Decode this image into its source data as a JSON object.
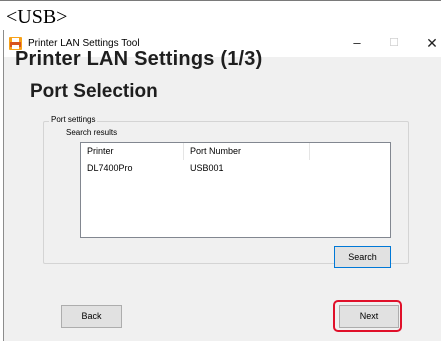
{
  "caption": "<USB>",
  "window": {
    "title": "Printer LAN Settings Tool",
    "controls": {
      "minimize": "–",
      "maximize": "☐",
      "close": "✕"
    }
  },
  "heading": "Printer LAN Settings (1/3)",
  "subheading": "Port Selection",
  "port_settings": {
    "legend": "Port settings",
    "search_results_label": "Search results",
    "columns": [
      "Printer",
      "Port Number",
      ""
    ],
    "rows": [
      {
        "printer": "DL7400Pro",
        "port": "USB001"
      }
    ]
  },
  "buttons": {
    "search": "Search",
    "back": "Back",
    "next": "Next"
  },
  "colors": {
    "highlight": "#e0102a",
    "focus_border": "#0078d7"
  }
}
